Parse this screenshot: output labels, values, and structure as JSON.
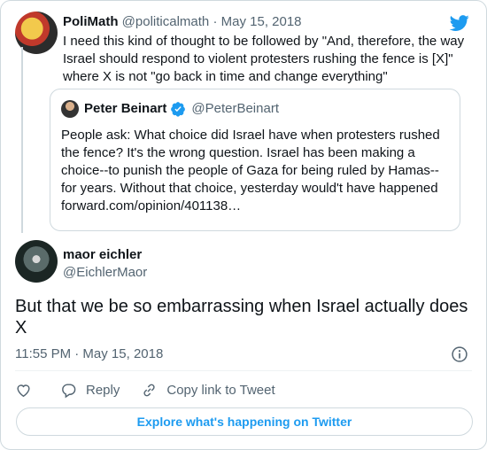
{
  "parent_tweet": {
    "author_name": "PoliMath",
    "author_handle": "@politicalmath",
    "separator": "·",
    "date": "May 15, 2018",
    "text": "I need this kind of thought to be followed by \"And, therefore, the way Israel should respond to violent protesters rushing the fence is [X]\" where X is not \"go back in time and change everything\""
  },
  "quoted_tweet": {
    "author_name": "Peter Beinart",
    "author_handle": "@PeterBeinart",
    "text": "People ask: What choice did Israel have when protesters rushed the fence? It's the wrong question. Israel has been making a choice--to punish the people of Gaza for being ruled by Hamas--for years. Without that choice, yesterday would't have happened forward.com/opinion/401138…"
  },
  "main_tweet": {
    "author_name": "maor eichler",
    "author_handle": "@EichlerMaor",
    "text": "But that we be so embarrassing when Israel actually does X",
    "timestamp": "11:55 PM · May 15, 2018"
  },
  "actions": {
    "reply_label": "Reply",
    "copy_link_label": "Copy link to Tweet"
  },
  "explore_label": "Explore what's happening on Twitter",
  "colors": {
    "accent": "#1d9bf0",
    "muted": "#536471",
    "border": "#cfd9de"
  },
  "icons": [
    "twitter-bird-icon",
    "verified-badge-icon",
    "info-icon",
    "heart-icon",
    "reply-icon",
    "link-icon"
  ]
}
